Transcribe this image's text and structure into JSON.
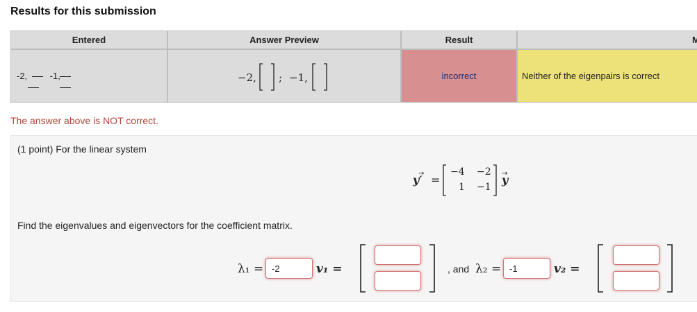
{
  "results": {
    "title": "Results for this submission",
    "columns": [
      "Entered",
      "Answer Preview",
      "Result",
      "M"
    ],
    "row": {
      "entered_text": "-2,         -1,",
      "preview": {
        "lambda1": "−2,",
        "separator": ";",
        "lambda2": "−1,"
      },
      "result": "incorrect",
      "message": "Neither of the eigenpairs is correct"
    },
    "colors": {
      "incorrect_bg": "#d88f8f",
      "message_bg": "#ede27a",
      "header_bg": "#dcdcdc"
    }
  },
  "warning": "The answer above is NOT correct.",
  "problem": {
    "intro": "(1 point) For the linear system",
    "equation": {
      "lhs": "y′",
      "equals": "=",
      "matrix": [
        [
          "−4",
          "−2"
        ],
        [
          "1",
          "−1"
        ]
      ],
      "rhs": "y"
    },
    "instruction": "Find the eigenvalues and eigenvectors for the coefficient matrix.",
    "answers": {
      "lambda1_label": "λ₁ =",
      "lambda1_value": "-2",
      "v1_label": "v₁ =",
      "and_label": ", and",
      "lambda2_label": "λ₂ =",
      "lambda2_value": "-1",
      "v2_label": "v₂ =",
      "v1": [
        "",
        ""
      ],
      "v2": [
        "",
        ""
      ]
    }
  }
}
